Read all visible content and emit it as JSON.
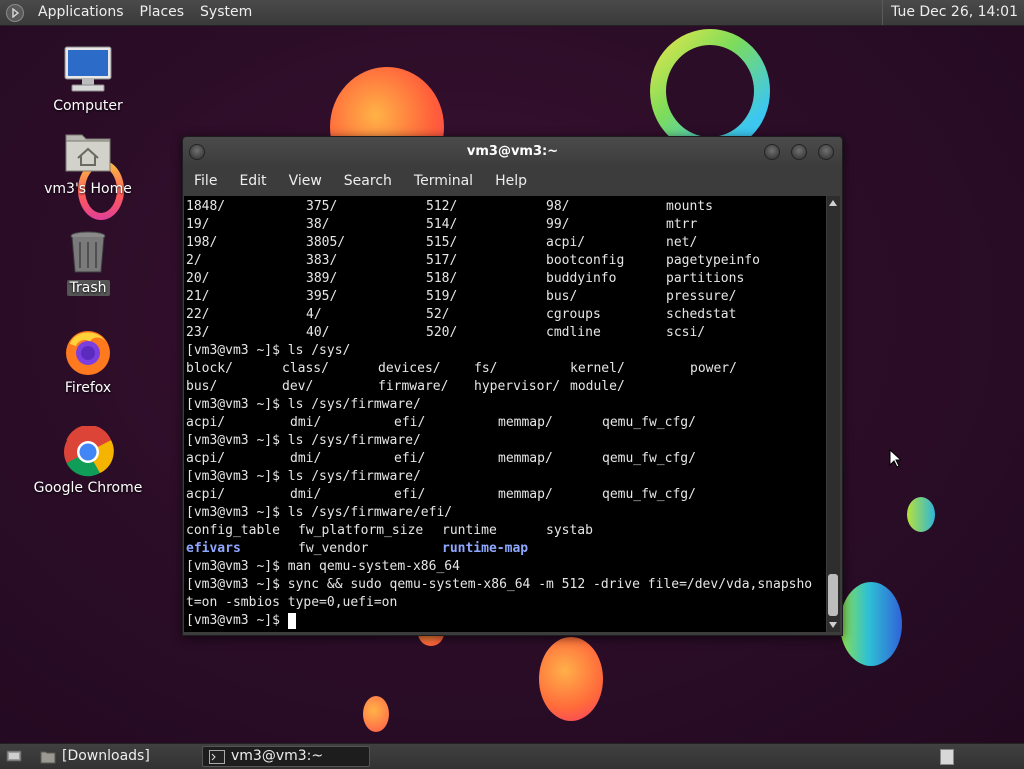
{
  "top_panel": {
    "menus": [
      "Applications",
      "Places",
      "System"
    ],
    "clock": "Tue Dec 26, 14:01"
  },
  "desktop_icons": [
    {
      "label": "Computer",
      "icon": "computer-icon"
    },
    {
      "label": "vm3's Home",
      "icon": "home-folder-icon"
    },
    {
      "label": "Trash",
      "icon": "trash-icon"
    },
    {
      "label": "Firefox",
      "icon": "firefox-icon"
    },
    {
      "label": "Google Chrome",
      "icon": "chrome-icon"
    }
  ],
  "terminal": {
    "title": "vm3@vm3:~",
    "menu": [
      "File",
      "Edit",
      "View",
      "Search",
      "Terminal",
      "Help"
    ],
    "lines": [
      {
        "cols": [
          "1848/",
          "375/",
          "512/",
          "98/",
          "mounts"
        ]
      },
      {
        "cols": [
          "19/",
          "38/",
          "514/",
          "99/",
          "mtrr"
        ]
      },
      {
        "cols": [
          "198/",
          "3805/",
          "515/",
          "acpi/",
          "net/"
        ]
      },
      {
        "cols": [
          "2/",
          "383/",
          "517/",
          "bootconfig",
          "pagetypeinfo"
        ]
      },
      {
        "cols": [
          "20/",
          "389/",
          "518/",
          "buddyinfo",
          "partitions"
        ]
      },
      {
        "cols": [
          "21/",
          "395/",
          "519/",
          "bus/",
          "pressure/"
        ]
      },
      {
        "cols": [
          "22/",
          "4/",
          "52/",
          "cgroups",
          "schedstat"
        ]
      },
      {
        "cols": [
          "23/",
          "40/",
          "520/",
          "cmdline",
          "scsi/"
        ]
      },
      {
        "text": "[vm3@vm3 ~]$ ls /sys/"
      },
      {
        "cols": [
          "block/",
          "class/",
          "devices/",
          "fs/",
          "kernel/",
          "power/"
        ]
      },
      {
        "cols": [
          "bus/",
          "dev/",
          "firmware/",
          "hypervisor/",
          "module/"
        ]
      },
      {
        "text": "[vm3@vm3 ~]$ ls /sys/firmware/"
      },
      {
        "cols": [
          "acpi/",
          "dmi/",
          "efi/",
          "memmap/",
          "qemu_fw_cfg/"
        ]
      },
      {
        "text": "[vm3@vm3 ~]$ ls /sys/firmware/"
      },
      {
        "cols": [
          "acpi/",
          "dmi/",
          "efi/",
          "memmap/",
          "qemu_fw_cfg/"
        ]
      },
      {
        "text": "[vm3@vm3 ~]$ ls /sys/firmware/"
      },
      {
        "cols": [
          "acpi/",
          "dmi/",
          "efi/",
          "memmap/",
          "qemu_fw_cfg/"
        ]
      },
      {
        "text": "[vm3@vm3 ~]$ ls /sys/firmware/efi/"
      },
      {
        "cols": [
          "config_table",
          "fw_platform_size",
          "runtime",
          "systab"
        ]
      },
      {
        "cols": [
          "efivars",
          "fw_vendor",
          "runtime-map"
        ],
        "dirs": [
          0,
          2
        ]
      },
      {
        "text": "[vm3@vm3 ~]$ man qemu-system-x86_64"
      },
      {
        "text": "[vm3@vm3 ~]$ sync && sudo qemu-system-x86_64 -m 512 -drive file=/dev/vda,snapsho"
      },
      {
        "text": "t=on -smbios type=0,uefi=on"
      },
      {
        "text": "[vm3@vm3 ~]$ ",
        "cursor": true
      }
    ]
  },
  "taskbar": {
    "items": [
      {
        "label": "[Downloads]",
        "icon": "folder-icon",
        "active": false
      },
      {
        "label": "vm3@vm3:~",
        "icon": "terminal-icon",
        "active": true
      }
    ]
  }
}
